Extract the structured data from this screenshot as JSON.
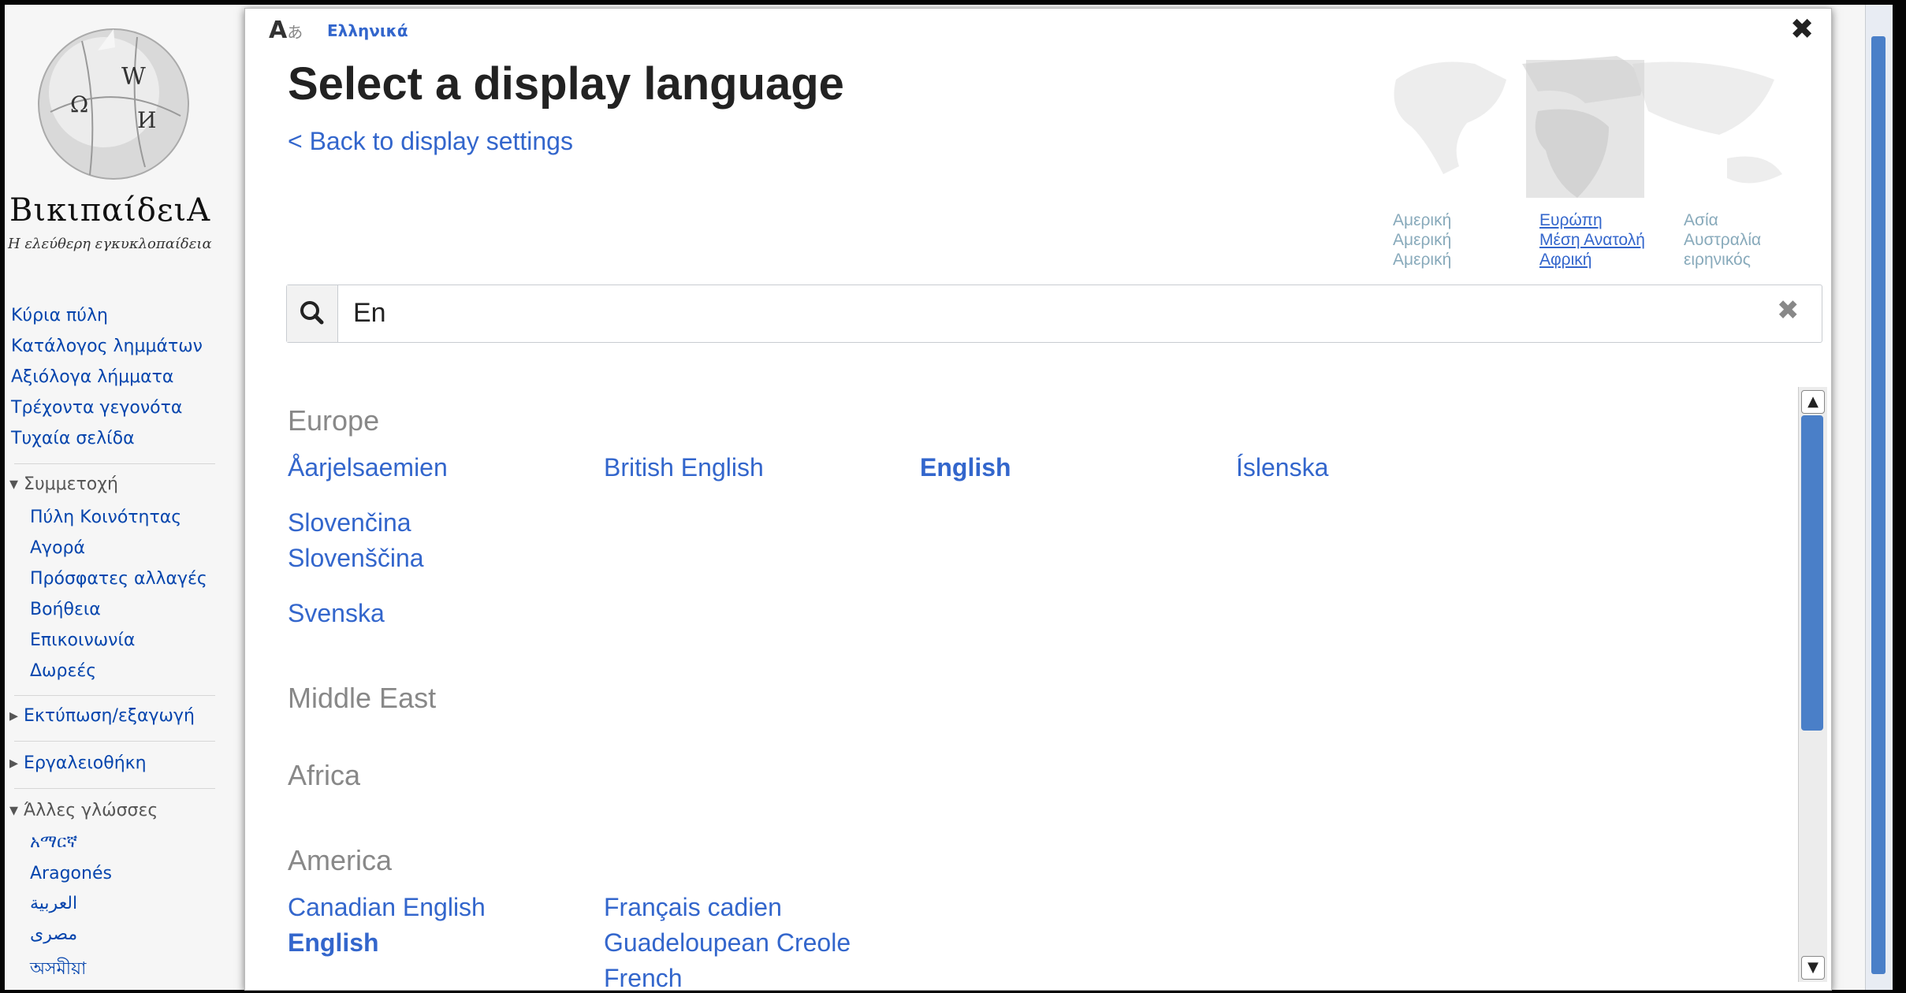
{
  "sidebar": {
    "wordmark": "ΒικιπαίδειΑ",
    "tagline": "Η ελεύθερη εγκυκλοπαίδεια",
    "nav": [
      "Κύρια πύλη",
      "Κατάλογος λημμάτων",
      "Αξιόλογα λήμματα",
      "Τρέχοντα γεγονότα",
      "Τυχαία σελίδα"
    ],
    "participation_heading": "Συμμετοχή",
    "participation": [
      "Πύλη Κοινότητας",
      "Αγορά",
      "Πρόσφατες αλλαγές",
      "Βοήθεια",
      "Επικοινωνία",
      "Δωρεές"
    ],
    "print_heading": "Εκτύπωση/εξαγωγή",
    "tools_heading": "Εργαλειοθήκη",
    "languages_heading": "Άλλες γλώσσες",
    "languages": [
      "አማርኛ",
      "Aragonés",
      "العربية",
      "مصرى",
      "অসমীয়া"
    ]
  },
  "dialog": {
    "current_language": "Ελληνικά",
    "title": "Select a display language",
    "back_link": "< Back to display settings",
    "regions": {
      "col1": [
        "Αμερική",
        "Αμερική",
        "Αμερική"
      ],
      "col2": [
        "Ευρώπη",
        "Μέση Ανατολή",
        "Αφρική"
      ],
      "col3": [
        "Ασία",
        "Αυστραλία",
        "ειρηνικός"
      ]
    },
    "search": {
      "value": "En"
    },
    "groups": {
      "europe": "Europe",
      "middle_east": "Middle East",
      "africa": "Africa",
      "america": "America"
    },
    "europe_langs": [
      "Åarjelsaemien",
      "British English",
      "English",
      "Íslenska",
      "Slovenčina",
      "Slovenščina",
      "Svenska"
    ],
    "america_langs": [
      "Canadian English",
      "English",
      "Français cadien",
      "Guadeloupean Creole",
      "French"
    ]
  },
  "colors": {
    "link": "#3366cc",
    "scrollbar_thumb": "#4a7fc8"
  }
}
